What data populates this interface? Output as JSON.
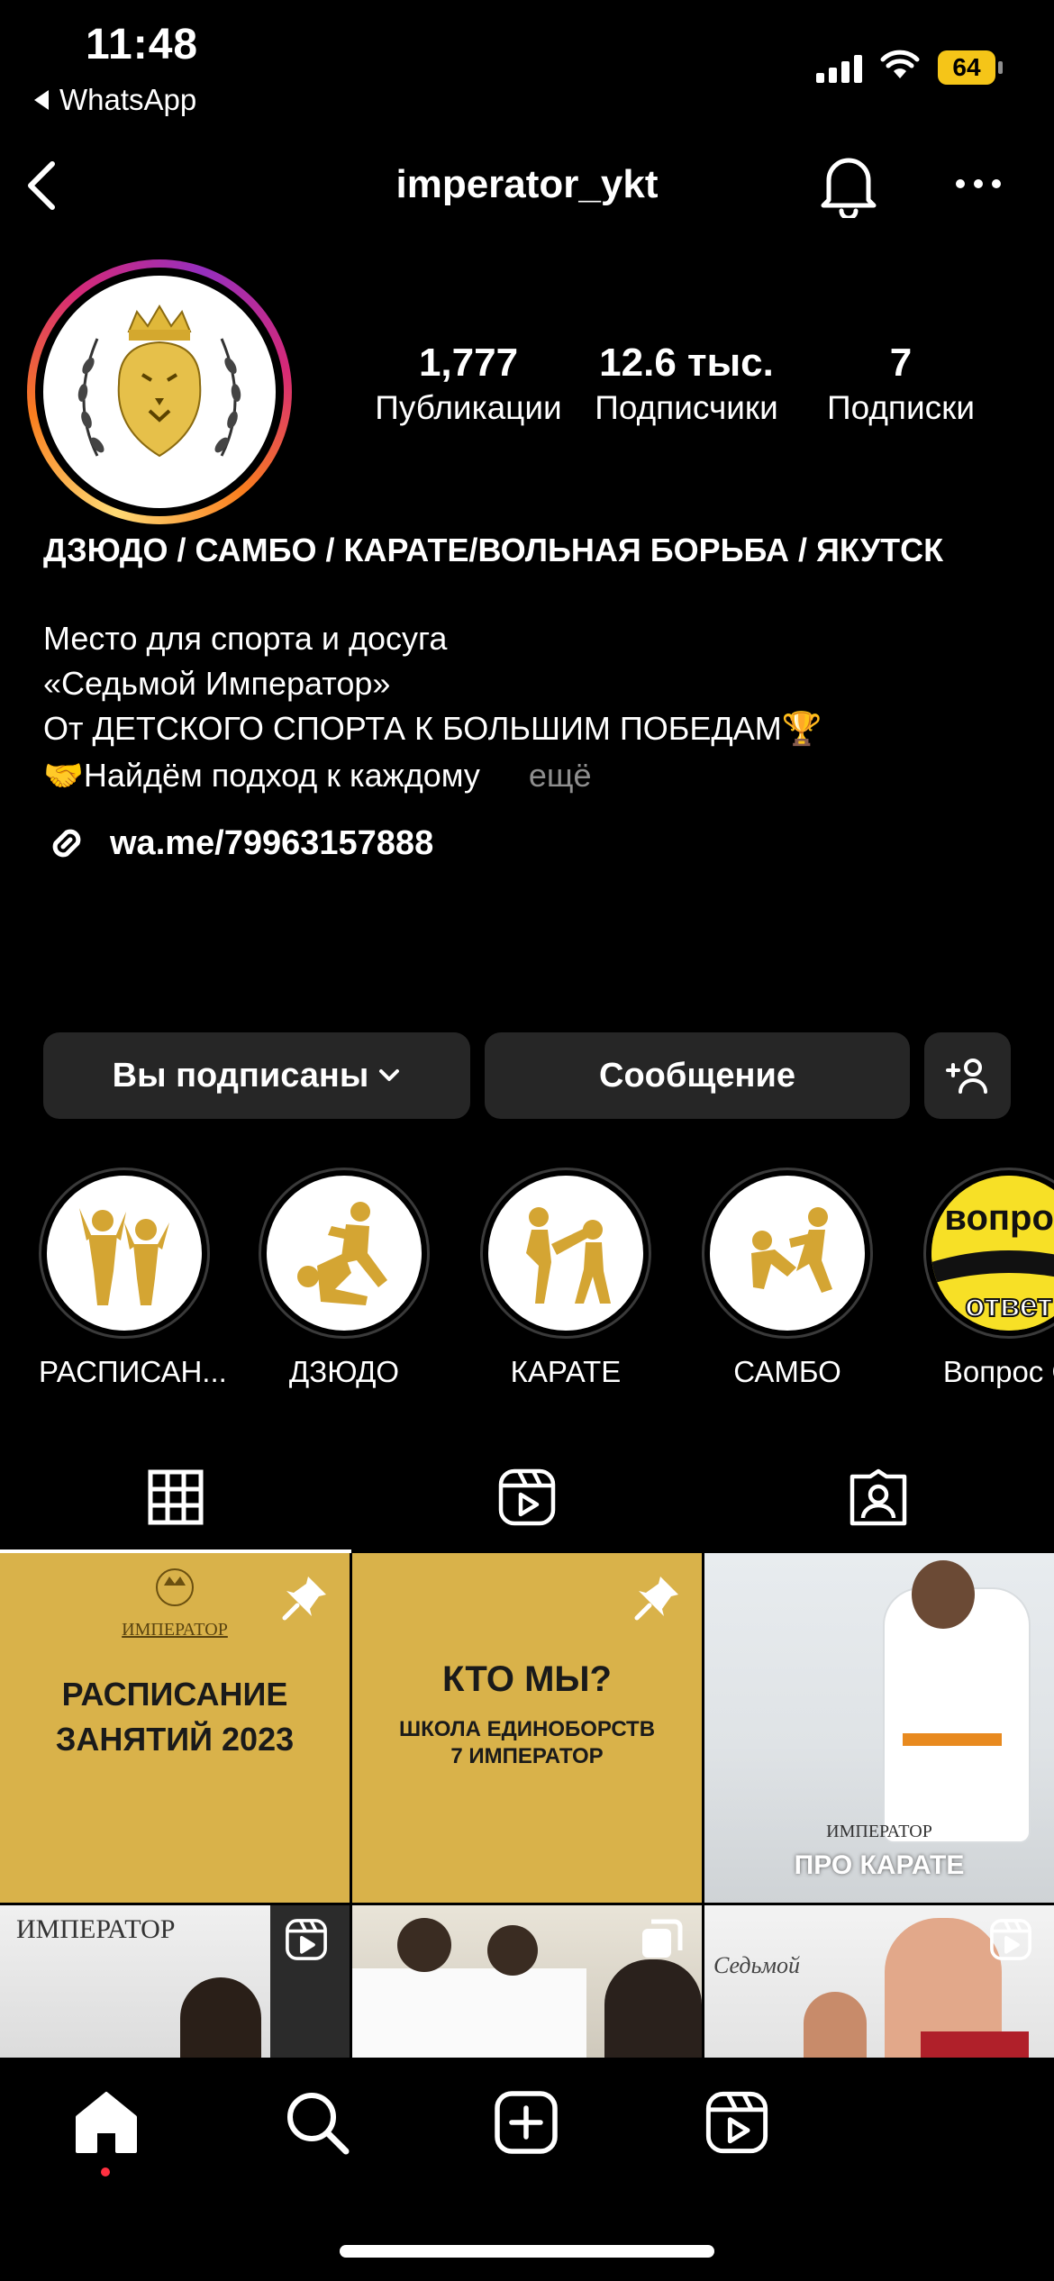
{
  "status_bar": {
    "time": "11:48",
    "back_app": "WhatsApp",
    "battery": "64"
  },
  "header": {
    "username": "imperator_ykt"
  },
  "stats": [
    {
      "value": "1,777",
      "label": "Публикации"
    },
    {
      "value": "12.6 тыс.",
      "label": "Подписчики"
    },
    {
      "value": "7",
      "label": "Подписки"
    }
  ],
  "bio": {
    "title": "ДЗЮДО / САМБО / КАРАТЕ/ВОЛЬНАЯ БОРЬБА / ЯКУТСК",
    "lines": [
      "Место для спорта и досуга",
      "«Седьмой Император»",
      "От ДЕТСКОГО СПОРТА К БОЛЬШИМ ПОБЕДАМ🏆",
      "🤝Найдём подход к каждому"
    ],
    "more": "ещё",
    "link": "wa.me/79963157888"
  },
  "actions": {
    "following": "Вы подписаны",
    "message": "Сообщение"
  },
  "highlights": [
    {
      "label": "РАСПИСАН..."
    },
    {
      "label": "ДЗЮДО"
    },
    {
      "label": "КАРАТЕ"
    },
    {
      "label": "САМБО"
    },
    {
      "label": "Вопрос О"
    }
  ],
  "highlight_badge": {
    "top": "вопрос",
    "bottom": "ответ"
  },
  "posts": {
    "p1": {
      "logo": "ИМПЕРАТОР",
      "title_1": "РАСПИСАНИЕ",
      "title_2": "ЗАНЯТИЙ 2023"
    },
    "p2": {
      "title": "КТО МЫ?",
      "sub_1": "ШКОЛА ЕДИНОБОРСТВ",
      "sub_2": "7 ИМПЕРАТОР"
    },
    "p3": {
      "logo": "ИМПЕРАТОР",
      "caption": "ПРО КАРАТЕ"
    },
    "p4": {
      "logo": "ИМПЕРАТОР"
    },
    "p6": {
      "logo": "Седьмой"
    }
  },
  "colors": {
    "accent_yellow": "#d9b24a",
    "button_bg": "#262626",
    "muted": "#8e8e8e",
    "battery": "#f5c518"
  }
}
